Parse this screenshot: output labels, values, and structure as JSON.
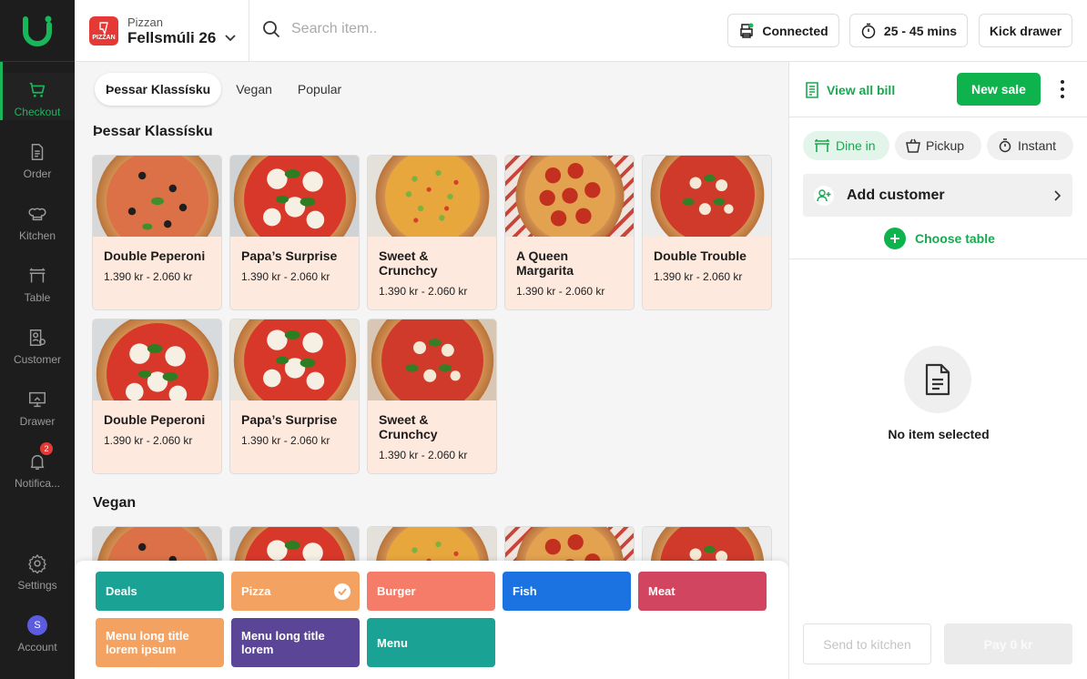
{
  "sidebar": {
    "items": [
      {
        "label": "Checkout",
        "icon": "cart-icon"
      },
      {
        "label": "Order",
        "icon": "document-icon"
      },
      {
        "label": "Kitchen",
        "icon": "chef-hat-icon"
      },
      {
        "label": "Table",
        "icon": "table-icon"
      },
      {
        "label": "Customer",
        "icon": "customer-icon"
      },
      {
        "label": "Drawer",
        "icon": "drawer-icon"
      },
      {
        "label": "Notifica...",
        "icon": "bell-icon",
        "badge": "2"
      }
    ],
    "settings_label": "Settings",
    "account_label": "Account",
    "account_initial": "S",
    "accent": "#18b85a"
  },
  "header": {
    "store_sub": "Pizzan",
    "store_name": "Fellsmúli 26",
    "store_logo_text": "PIZZAN",
    "search_placeholder": "Search item..",
    "connected_label": "Connected",
    "time_label": "25 - 45 mins",
    "kick_drawer_label": "Kick drawer"
  },
  "main": {
    "tabs": [
      "Þessar Klassísku",
      "Vegan",
      "Popular"
    ],
    "sections": [
      {
        "title": "Þessar Klassísku",
        "items": [
          {
            "name": "Double Peperoni",
            "price": "1.390 kr - 2.060 kr"
          },
          {
            "name": "Papa’s Surprise",
            "price": "1.390 kr - 2.060 kr"
          },
          {
            "name": "Sweet & Crunchcy",
            "price": "1.390 kr - 2.060 kr"
          },
          {
            "name": "A Queen Margarita",
            "price": "1.390 kr - 2.060 kr"
          },
          {
            "name": "Double Trouble",
            "price": "1.390 kr - 2.060 kr"
          },
          {
            "name": "Double Peperoni",
            "price": "1.390 kr - 2.060 kr"
          },
          {
            "name": "Papa’s Surprise",
            "price": "1.390 kr - 2.060 kr"
          },
          {
            "name": "Sweet & Crunchcy",
            "price": "1.390 kr - 2.060 kr"
          }
        ]
      },
      {
        "title": "Vegan"
      }
    ]
  },
  "categories": [
    {
      "label": "Deals",
      "color": "#1aa394"
    },
    {
      "label": "Pizza",
      "color": "#f4a261",
      "selected": true
    },
    {
      "label": "Burger",
      "color": "#f47c68"
    },
    {
      "label": "Fish",
      "color": "#1a73e0"
    },
    {
      "label": "Meat",
      "color": "#d14560"
    },
    {
      "label": "Menu long title lorem ipsum",
      "color": "#f4a261"
    },
    {
      "label": "Menu long title lorem",
      "color": "#5b4597"
    },
    {
      "label": "Menu",
      "color": "#1aa394"
    }
  ],
  "bill": {
    "view_all_label": "View all bill",
    "new_sale_label": "New sale",
    "order_types": [
      "Dine in",
      "Pickup",
      "Instant"
    ],
    "add_customer_label": "Add customer",
    "choose_table_label": "Choose table",
    "empty_label": "No item selected",
    "send_kitchen_label": "Send to kitchen",
    "pay_label": "Pay 0 kr"
  }
}
